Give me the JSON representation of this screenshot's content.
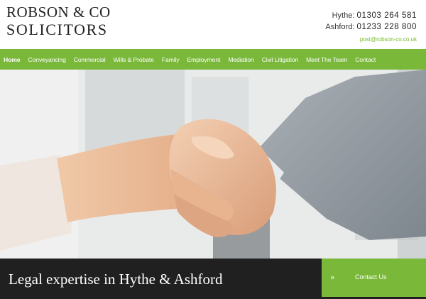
{
  "header": {
    "logo": {
      "line1": "ROBSON & CO",
      "line2": "SOLICITORS"
    },
    "contacts": [
      {
        "place": "Hythe:",
        "number": "01303 264 581"
      },
      {
        "place": "Ashford:",
        "number": "01233 228 800"
      }
    ],
    "email": "post@robson-co.co.uk"
  },
  "nav": {
    "items": [
      {
        "label": "Home",
        "active": true
      },
      {
        "label": "Conveyancing"
      },
      {
        "label": "Commercial"
      },
      {
        "label": "Wills & Probate"
      },
      {
        "label": "Family"
      },
      {
        "label": "Employment"
      },
      {
        "label": "Mediation"
      },
      {
        "label": "Civil Litigation"
      },
      {
        "label": "Meet The Team"
      },
      {
        "label": "Contact"
      }
    ]
  },
  "hero": {
    "tagline": "Legal expertise in Hythe & Ashford",
    "cta": {
      "label": "Contact Us",
      "icon": "double-chevron-right-icon"
    }
  },
  "colors": {
    "accent_green": "#7ab83a",
    "band_dark": "#202020",
    "email_green": "#76b82a"
  }
}
